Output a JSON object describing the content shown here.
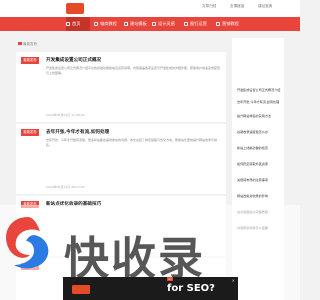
{
  "topbar": {
    "links": [
      "文章归档",
      "友情链接",
      "建站宝典"
    ]
  },
  "nav": {
    "items": [
      {
        "label": "首页",
        "active": true
      },
      {
        "label": "电商教程",
        "active": false
      },
      {
        "label": "建站模板",
        "active": false
      },
      {
        "label": "设计灵感",
        "active": false
      },
      {
        "label": "图钉运营",
        "active": false
      },
      {
        "label": "营销教程",
        "active": false
      }
    ]
  },
  "breadcrumb": {
    "label": "最新发布"
  },
  "cards": [
    {
      "tag": "最新发布",
      "title": "开发集成设置公司正式概况",
      "desc": "开发集成设置公司正式概况介绍平台的基础功能模块及运营说明，内容涵盖各项设置与开发集成的详细步骤，帮助用户快速完成配置与上线部署。",
      "date": "2024年05月02日  11:48:02"
    },
    {
      "tag": "最新发布",
      "title": "去年开张,今年才有流,如何处理",
      "desc": "去年开张，今年才开始有流量，很多新站都会遇到类似的问题，本文总结了排查思路与优化方向，帮助站长更快提升网站收录与排名。",
      "date": "2024年05月11日  08:27:53"
    },
    {
      "tag": "最新发布",
      "title": "新站点优化收录的基础技巧",
      "desc": "",
      "date": ""
    },
    {
      "tag": "最新发布",
      "title": "",
      "desc": "",
      "date": ""
    }
  ],
  "sidebar": {
    "links": [
      "开发集成设置公司正式概况介绍",
      "去年开张,今年才有流,如何处理",
      "提升网站排名的实用方法",
      "谷歌收录速度慢怎么办",
      "新站上线前必做的检查",
      "如何稳定获取外链资源",
      "关键词布局的注意事项",
      "网站改版对收录的影响",
      "站点地图提交完整教程",
      "内容更新频率怎么把握"
    ]
  },
  "watermark": {
    "text": "快收录"
  },
  "ad": {
    "text": "for SEO?",
    "badge": "Ad",
    "close": "✕"
  }
}
